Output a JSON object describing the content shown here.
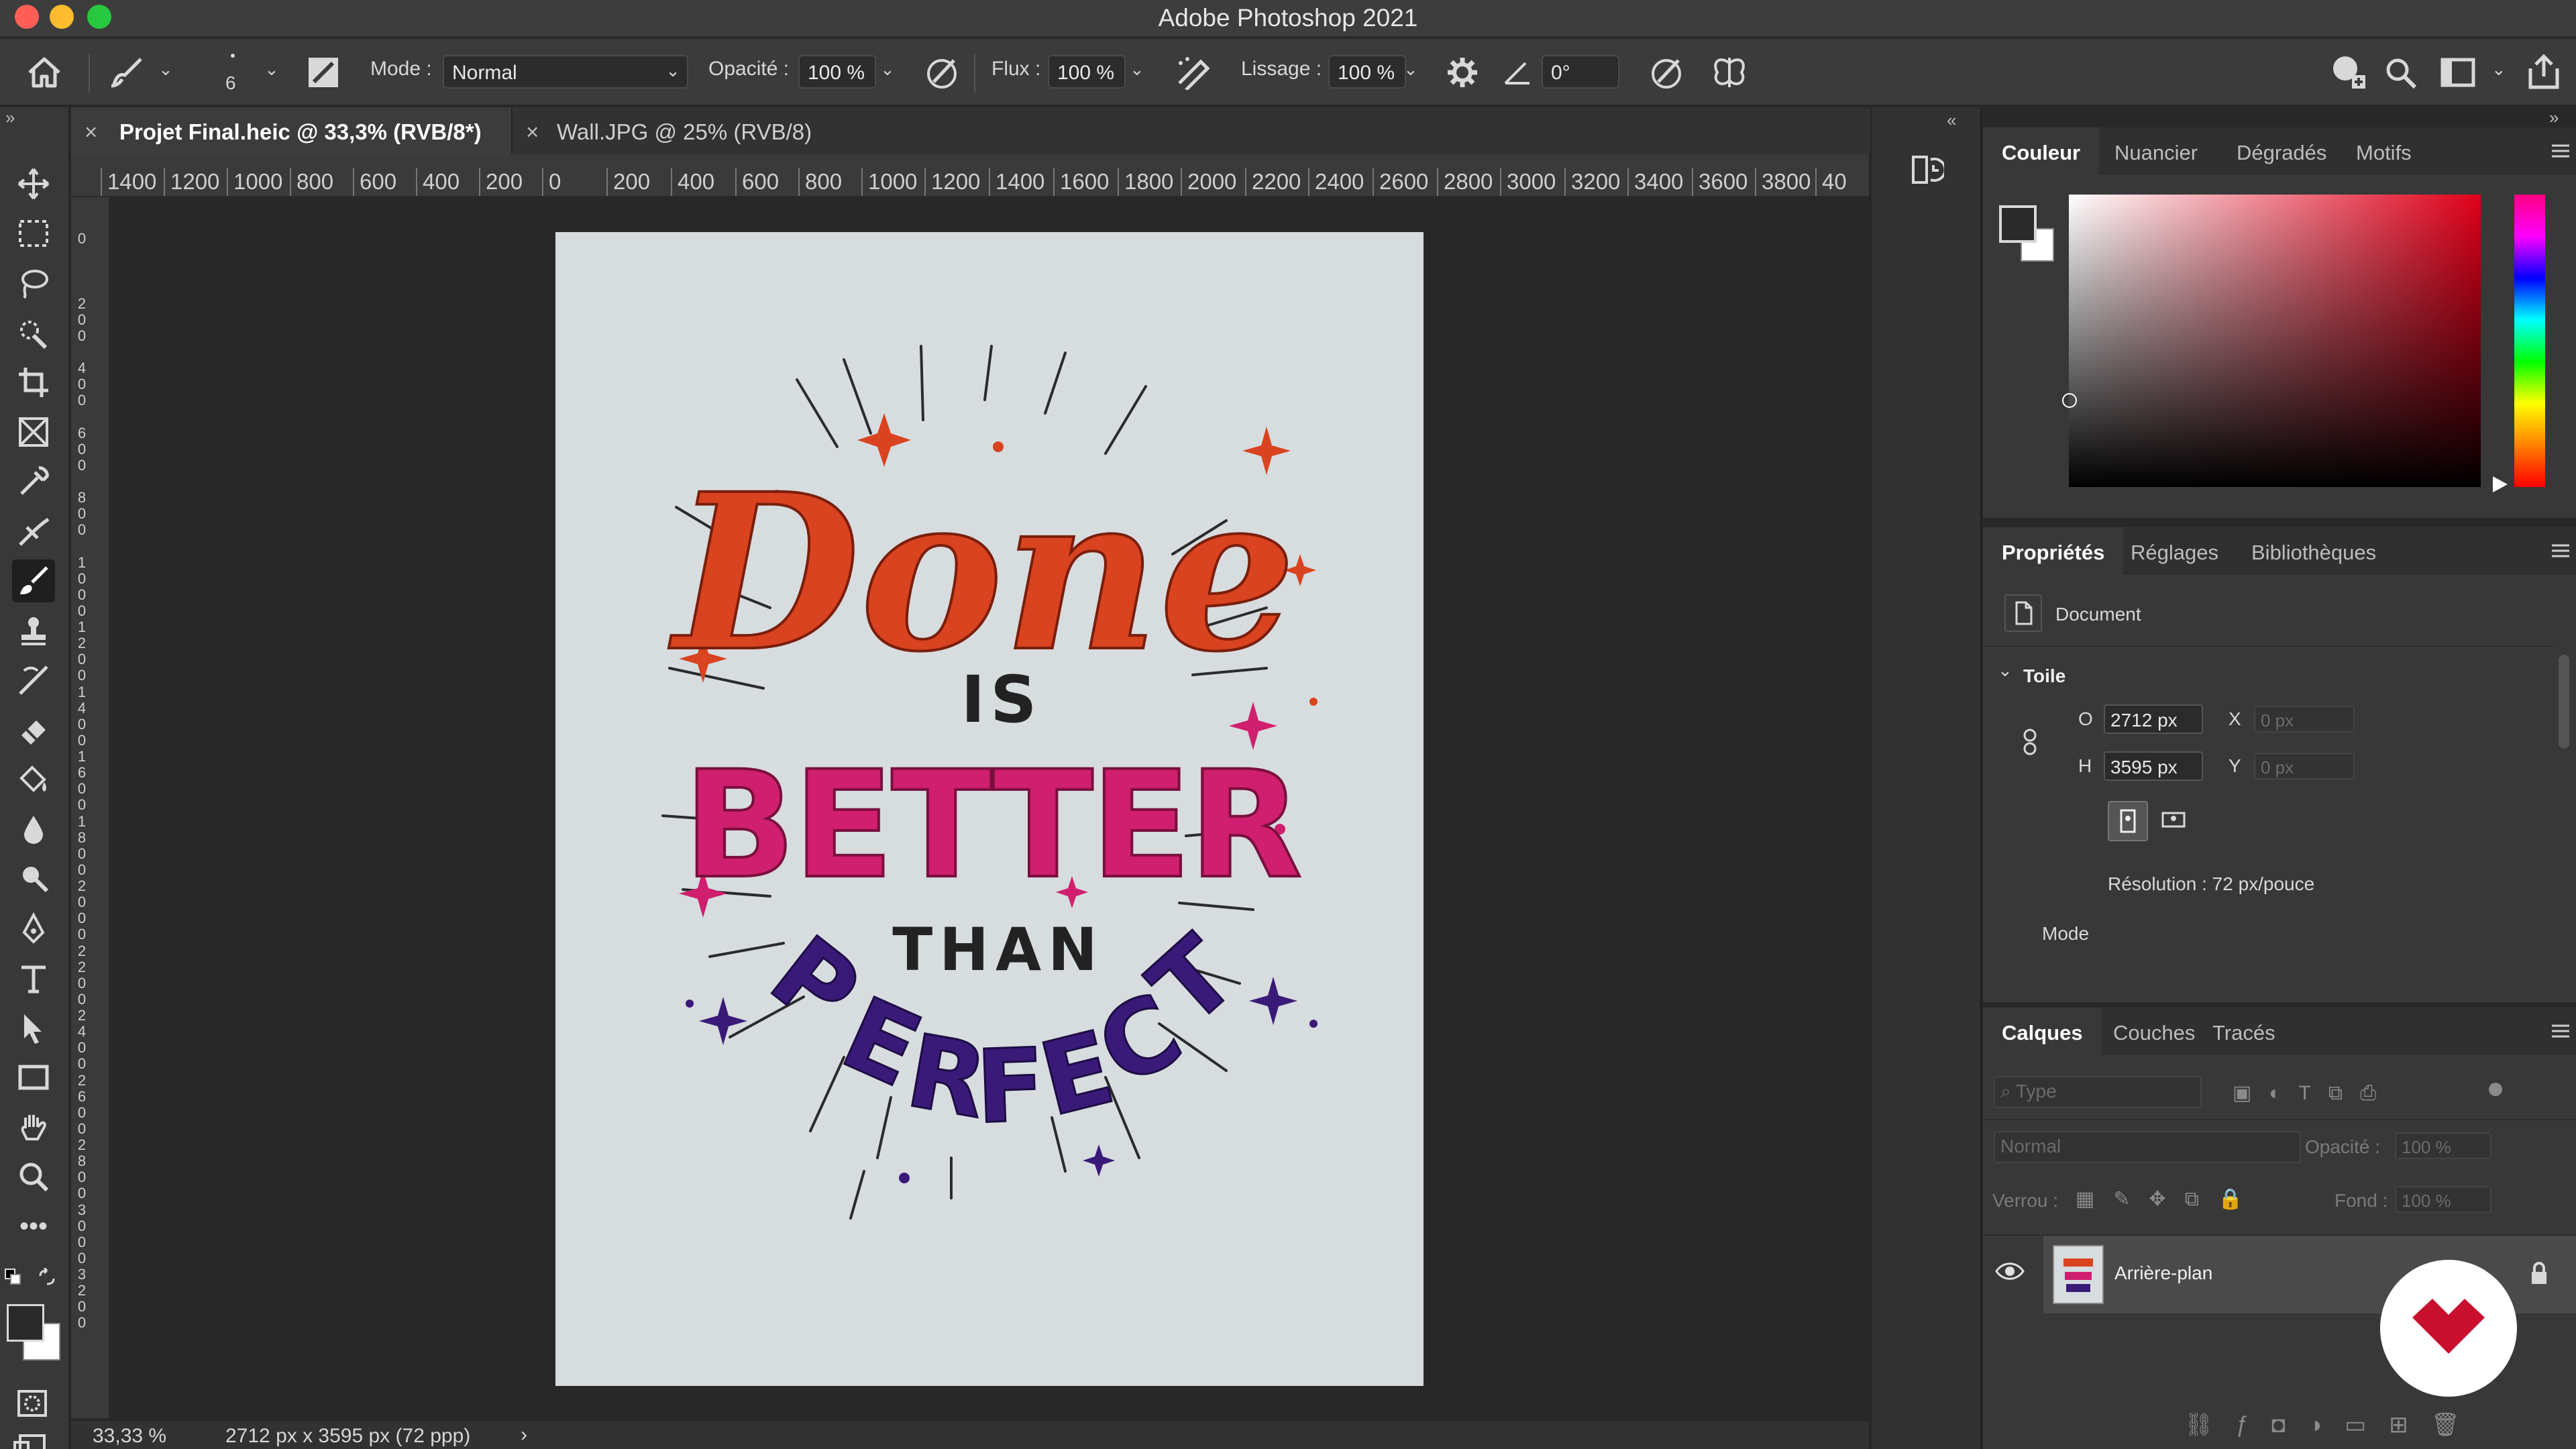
{
  "window": {
    "title": "Adobe Photoshop 2021"
  },
  "options_bar": {
    "brush_size": "6",
    "mode_label": "Mode :",
    "mode_value": "Normal",
    "opacity_label": "Opacité :",
    "opacity_value": "100 %",
    "flow_label": "Flux :",
    "flow_value": "100 %",
    "smoothing_label": "Lissage :",
    "smoothing_value": "100 %",
    "angle_value": "0°"
  },
  "tabs": [
    {
      "label": "Projet Final.heic @ 33,3% (RVB/8*)",
      "active": true
    },
    {
      "label": "Wall.JPG @ 25% (RVB/8)",
      "active": false
    }
  ],
  "ruler": {
    "h_ticks": [
      "1400",
      "1200",
      "1000",
      "800",
      "600",
      "400",
      "200",
      "0",
      "200",
      "400",
      "600",
      "800",
      "1000",
      "1200",
      "1400",
      "1600",
      "1800",
      "2000",
      "2200",
      "2400",
      "2600",
      "2800",
      "3000",
      "3200",
      "3400",
      "3600",
      "3800",
      "40"
    ],
    "v_ticks": [
      [
        "0"
      ],
      [
        "2",
        "0",
        "0"
      ],
      [
        "4",
        "0",
        "0"
      ],
      [
        "6",
        "0",
        "0"
      ],
      [
        "8",
        "0",
        "0"
      ],
      [
        "1",
        "0",
        "0",
        "0"
      ],
      [
        "1",
        "2",
        "0",
        "0"
      ],
      [
        "1",
        "4",
        "0",
        "0"
      ],
      [
        "1",
        "6",
        "0",
        "0"
      ],
      [
        "1",
        "8",
        "0",
        "0"
      ],
      [
        "2",
        "0",
        "0",
        "0"
      ],
      [
        "2",
        "2",
        "0",
        "0"
      ],
      [
        "2",
        "4",
        "0",
        "0"
      ],
      [
        "2",
        "6",
        "0",
        "0"
      ],
      [
        "2",
        "8",
        "0",
        "0"
      ],
      [
        "3",
        "0",
        "0",
        "0"
      ],
      [
        "3",
        "2",
        "0",
        "0"
      ]
    ]
  },
  "artwork": {
    "line1": "Done",
    "line2": "IS",
    "line3": "BETTER",
    "line4": "THAN",
    "line5_letters": [
      "P",
      "E",
      "R",
      "F",
      "E",
      "C",
      "T"
    ],
    "colors": {
      "done": "#d9431f",
      "better": "#cf1f6e",
      "than": "#222222",
      "perfect": "#3a1a78",
      "paper": "#d6dbdf"
    }
  },
  "status_bar": {
    "zoom": "33,33 %",
    "doc_info": "2712 px x 3595 px (72 ppp)"
  },
  "color_panel": {
    "tabs": [
      "Couleur",
      "Nuancier",
      "Dégradés",
      "Motifs"
    ],
    "hue_color": "#e0001a"
  },
  "properties_panel": {
    "tabs": [
      "Propriétés",
      "Réglages",
      "Bibliothèques"
    ],
    "doc_label": "Document",
    "section": "Toile",
    "w_label": "O",
    "w_value": "2712 px",
    "h_label": "H",
    "h_value": "3595 px",
    "x_label": "X",
    "x_placeholder": "0 px",
    "y_label": "Y",
    "y_placeholder": "0 px",
    "resolution": "Résolution : 72 px/pouce",
    "mode_label": "Mode"
  },
  "layers_panel": {
    "tabs": [
      "Calques",
      "Couches",
      "Tracés"
    ],
    "filter_placeholder": "Type",
    "blend_mode": "Normal",
    "opacity_label": "Opacité :",
    "opacity_value": "100 %",
    "lock_label": "Verrou :",
    "fill_label": "Fond :",
    "fill_value": "100 %",
    "layers": [
      {
        "name": "Arrière-plan",
        "visible": true,
        "locked": true
      }
    ]
  },
  "accent": {
    "brand_badge": "#c8102e",
    "titlebar": "#3d3d3d"
  }
}
